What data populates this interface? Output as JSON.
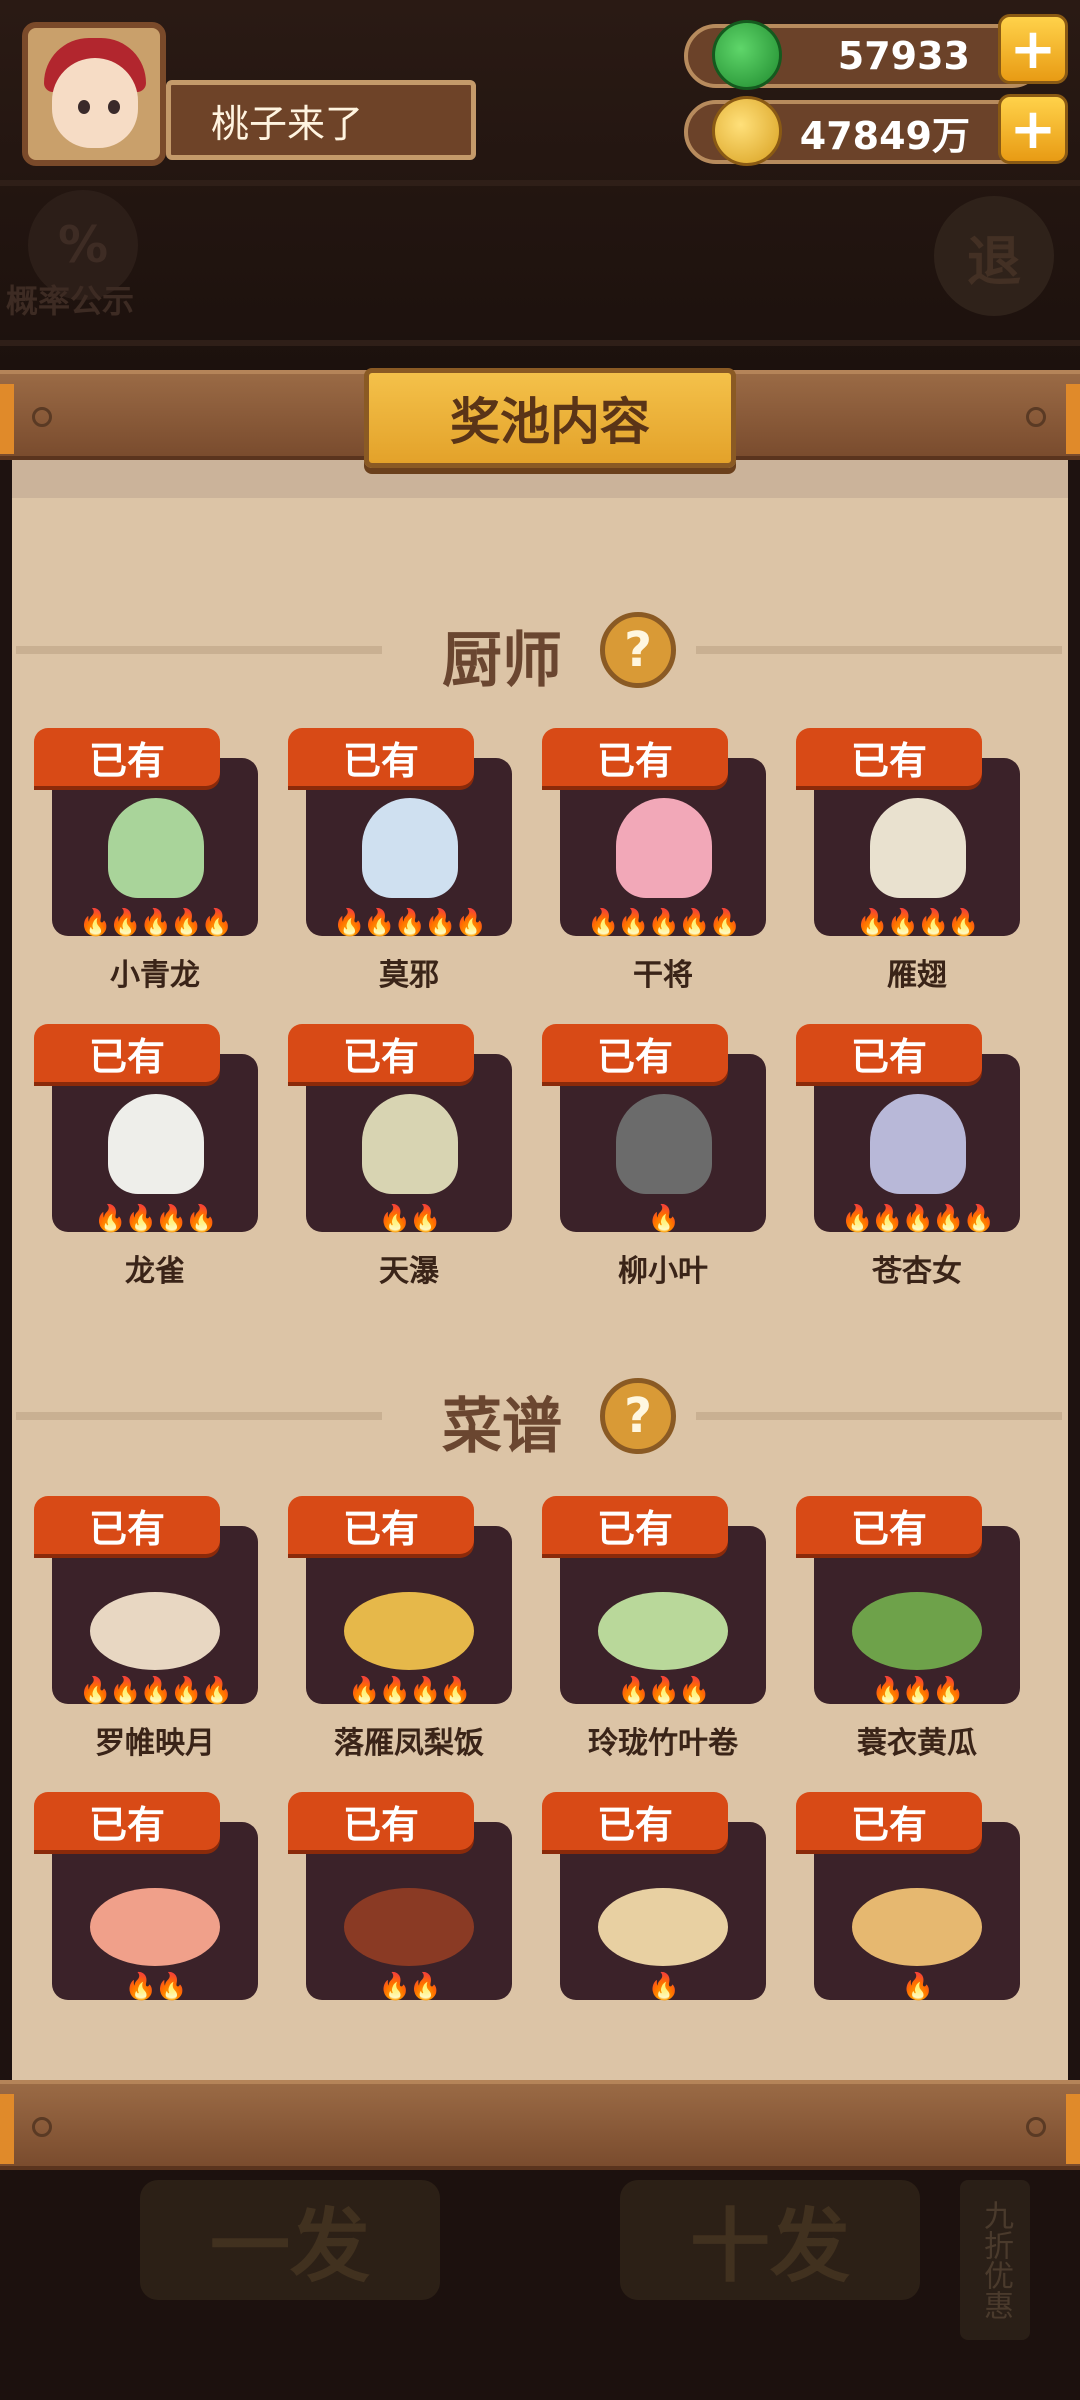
{
  "player": {
    "name": "桃子来了"
  },
  "currency": {
    "jade": "57933",
    "gold": "47849万"
  },
  "background": {
    "probability_label": "概率公示",
    "exit_label": "退",
    "single_draw_label": "一发",
    "ten_draw_label": "十发",
    "discount_label": "九折优惠"
  },
  "modal": {
    "title": "奖池内容",
    "chefs_section": "厨师",
    "recipes_section": "菜谱",
    "help_glyph": "?"
  },
  "chefs": [
    {
      "name": "小青龙",
      "badge": "已有",
      "stars": 5,
      "color": "#a9d49a"
    },
    {
      "name": "莫邪",
      "badge": "已有",
      "stars": 5,
      "color": "#cfe0f0"
    },
    {
      "name": "干将",
      "badge": "已有",
      "stars": 5,
      "color": "#f2a8b8"
    },
    {
      "name": "雁翅",
      "badge": "已有",
      "stars": 4,
      "color": "#e9e1cf"
    },
    {
      "name": "龙雀",
      "badge": "已有",
      "stars": 4,
      "color": "#eeeeea"
    },
    {
      "name": "天瀑",
      "badge": "已有",
      "stars": 2,
      "color": "#d8d4b2"
    },
    {
      "name": "柳小叶",
      "badge": "已有",
      "stars": 1,
      "color": "#6b6b6b"
    },
    {
      "name": "苍杏女",
      "badge": "已有",
      "stars": 5,
      "color": "#b8b8d8"
    }
  ],
  "recipes": [
    {
      "name": "罗帷映月",
      "badge": "已有",
      "stars": 5,
      "color": "#e8d7c2"
    },
    {
      "name": "落雁凤梨饭",
      "badge": "已有",
      "stars": 4,
      "color": "#e6b84a"
    },
    {
      "name": "玲珑竹叶卷",
      "badge": "已有",
      "stars": 3,
      "color": "#b9d89a"
    },
    {
      "name": "蓑衣黄瓜",
      "badge": "已有",
      "stars": 3,
      "color": "#6ea24a"
    },
    {
      "name": "",
      "badge": "已有",
      "stars": 2,
      "color": "#f0a08a"
    },
    {
      "name": "",
      "badge": "已有",
      "stars": 2,
      "color": "#8a3a24"
    },
    {
      "name": "",
      "badge": "已有",
      "stars": 1,
      "color": "#e8d0a2"
    },
    {
      "name": "",
      "badge": "已有",
      "stars": 1,
      "color": "#e6b870"
    }
  ]
}
